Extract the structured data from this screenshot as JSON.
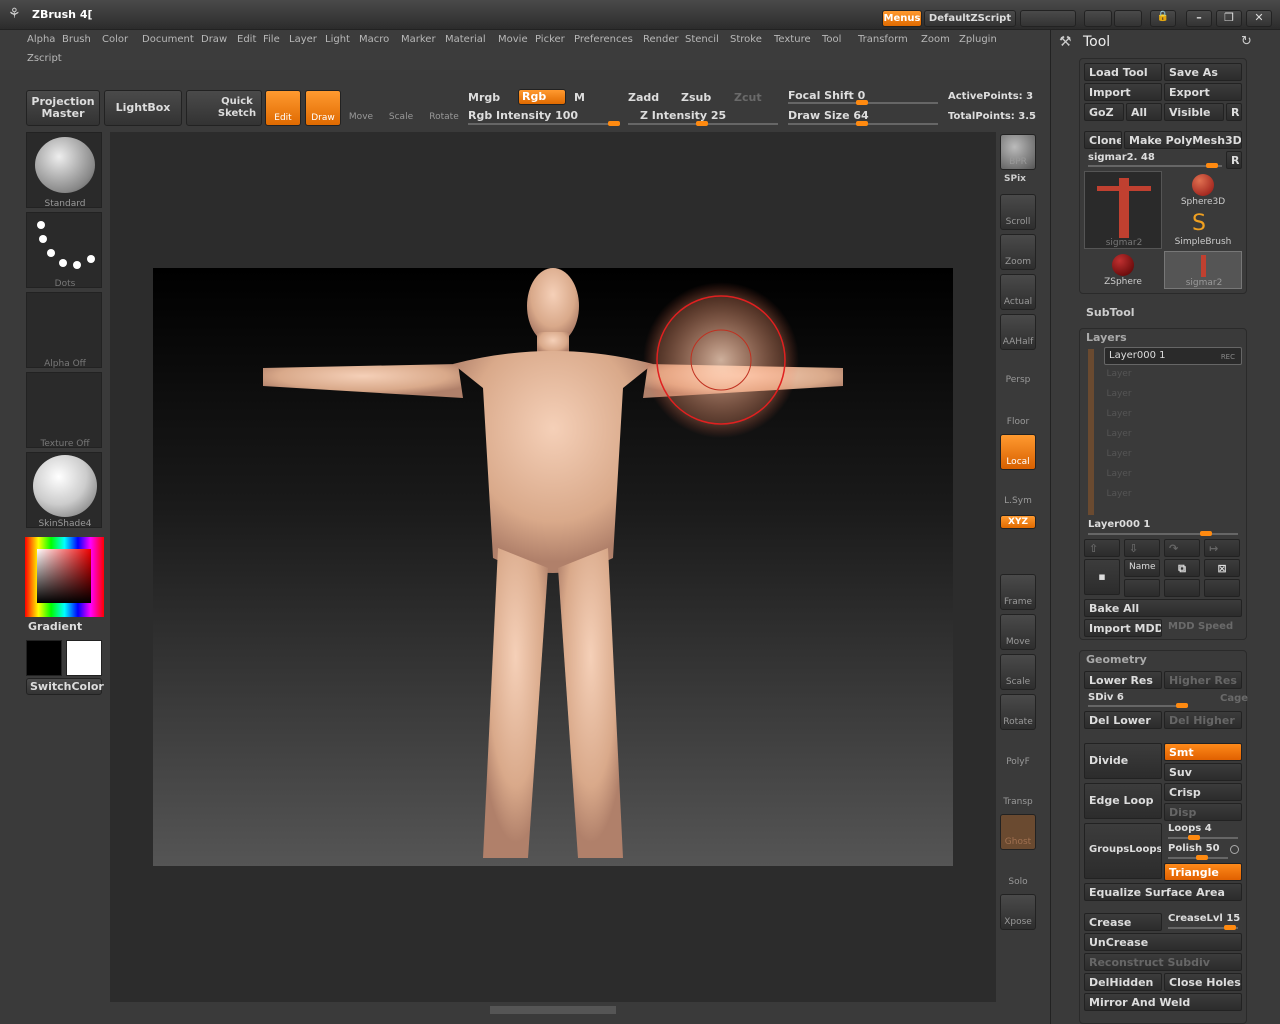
{
  "app": {
    "title": "ZBrush 4["
  },
  "titlebar": {
    "menus_btn": "Menus",
    "script_btn": "DefaultZScript"
  },
  "menubar": {
    "items": [
      "Alpha",
      "Brush",
      "Color",
      "Document",
      "Draw",
      "Edit",
      "File",
      "Layer",
      "Light",
      "Macro",
      "Marker",
      "Material",
      "Movie",
      "Picker",
      "Preferences",
      "Render",
      "Stencil",
      "Stroke",
      "Texture",
      "Tool",
      "Transform",
      "Zoom",
      "Zplugin",
      "Zscript"
    ]
  },
  "shelf": {
    "projection_master": "Projection Master",
    "lightbox": "LightBox",
    "quick_sketch": "Quick Sketch",
    "edit": "Edit",
    "draw": "Draw",
    "move": "Move",
    "scale": "Scale",
    "rotate": "Rotate",
    "mrgb": "Mrgb",
    "rgb": "Rgb",
    "m": "M",
    "zadd": "Zadd",
    "zsub": "Zsub",
    "zcut": "Zcut",
    "rgb_intensity": "Rgb Intensity 100",
    "z_intensity": "Z Intensity 25",
    "focal_shift": "Focal Shift 0",
    "draw_size": "Draw Size 64",
    "active_points": "ActivePoints: 3",
    "total_points": "TotalPoints: 3.5"
  },
  "left": {
    "brush": "Standard",
    "stroke": "Dots",
    "alpha": "Alpha Off",
    "texture": "Texture Off",
    "material": "SkinShade4",
    "gradient": "Gradient",
    "switchcolor": "SwitchColor"
  },
  "right_shelf": [
    "BPR",
    "SPix",
    "Scroll",
    "Zoom",
    "Actual",
    "AAHalf",
    "Persp",
    "Floor",
    "Local",
    "L.Sym",
    "XYZ",
    "Frame",
    "Move",
    "Scale",
    "Rotate",
    "PolyF",
    "Transp",
    "Ghost",
    "Solo",
    "Xpose"
  ],
  "tool": {
    "title": "Tool",
    "load": "Load Tool",
    "save": "Save As",
    "import": "Import",
    "export": "Export",
    "goz": "GoZ",
    "all": "All",
    "visible": "Visible",
    "r": "R",
    "clone": "Clone",
    "make_polymesh": "Make PolyMesh3D",
    "sigmar": "sigmar2. 48",
    "thumbs": [
      "sigmar2",
      "Sphere3D",
      "SimpleBrush",
      "ZSphere",
      "sigmar2"
    ],
    "subtool": "SubTool",
    "layers": "Layers",
    "layer_active": "Layer000 1",
    "rec": "REC",
    "layer": "Layer",
    "layer_label": "Layer000 1",
    "name": "Name",
    "bake_all": "Bake All",
    "import_mdd": "Import MDD",
    "mdd_speed": "MDD Speed",
    "geometry": "Geometry",
    "lower_res": "Lower Res",
    "higher_res": "Higher Res",
    "sdiv": "SDiv 6",
    "cage": "Cage",
    "del_lower": "Del Lower",
    "del_higher": "Del Higher",
    "divide": "Divide",
    "smt": "Smt",
    "suv": "Suv",
    "edge_loop": "Edge Loop",
    "crisp": "Crisp",
    "disp": "Disp",
    "groupsloops": "GroupsLoops",
    "loops": "Loops 4",
    "polish": "Polish 50",
    "triangle": "Triangle",
    "equalize": "Equalize Surface Area",
    "crease": "Crease",
    "creaselvl": "CreaseLvl 15",
    "uncrease": "UnCrease",
    "reconstruct": "Reconstruct Subdiv",
    "delhidden": "DelHidden",
    "close_holes": "Close Holes",
    "mirror_weld": "Mirror And Weld"
  }
}
